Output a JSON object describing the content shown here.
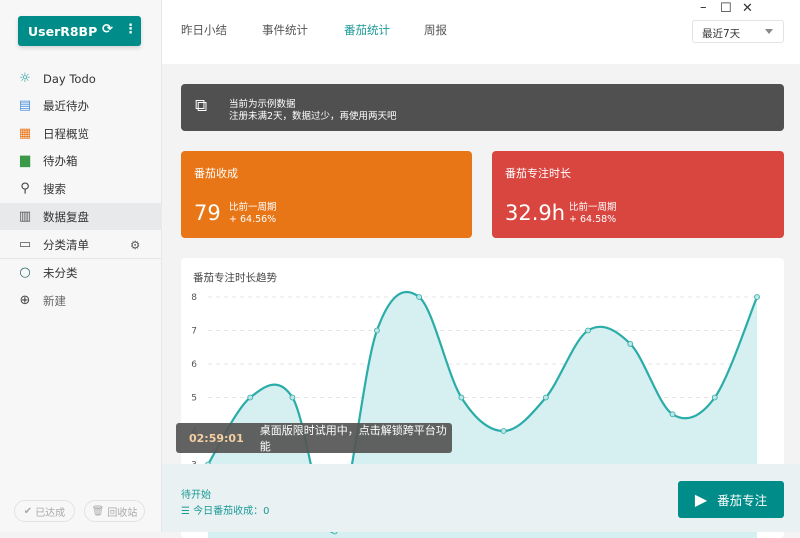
{
  "sidebar": {
    "user": "UserR8BP",
    "items": [
      {
        "label": "Day Todo",
        "icon": "sun-icon"
      },
      {
        "label": "最近待办",
        "icon": "calendar-icon"
      },
      {
        "label": "日程概览",
        "icon": "schedule-icon"
      },
      {
        "label": "待办箱",
        "icon": "inbox-icon"
      },
      {
        "label": "搜索",
        "icon": "search-icon"
      },
      {
        "label": "数据复盘",
        "icon": "chart-icon"
      },
      {
        "label": "分类清单",
        "icon": "list-box-icon"
      }
    ],
    "uncategorized": "未分类",
    "new": "新建",
    "done": "已达成",
    "trash": "回收站"
  },
  "header": {
    "tabs": [
      "昨日小结",
      "事件统计",
      "番茄统计",
      "周报"
    ],
    "active_tab": 2,
    "range": "最近7天"
  },
  "banner": {
    "line1": "当前为示例数据",
    "line2": "注册未满2天，数据过少，再使用两天吧"
  },
  "cards": [
    {
      "title": "番茄收成",
      "value": "79",
      "compare": "比前一周期",
      "delta": "+ 64.56%",
      "color": "#e87516"
    },
    {
      "title": "番茄专注时长",
      "value": "32.9h",
      "compare": "比前一周期",
      "delta": "+ 64.58%",
      "color": "#d94640"
    }
  ],
  "chart_data": {
    "type": "area",
    "title": "番茄专注时长趋势",
    "y_ticks": [
      "3",
      "4",
      "5",
      "6",
      "7",
      "8"
    ],
    "values": [
      3,
      5,
      5,
      1,
      7,
      8,
      5,
      4,
      5,
      7,
      6.6,
      4.5,
      5,
      8
    ],
    "ylim": [
      0,
      8
    ],
    "grid": true,
    "color": "#2aaca8"
  },
  "toast": {
    "time": "02:59:01",
    "text": "桌面版限时试用中，点击解锁跨平台功能"
  },
  "footer": {
    "status": "待开始",
    "today": "今日番茄收成：0",
    "button": "番茄专注"
  }
}
